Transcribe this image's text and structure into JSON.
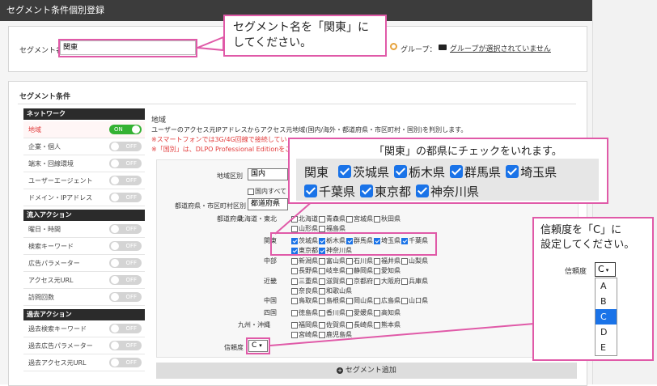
{
  "header": {
    "title": "セグメント条件個別登録"
  },
  "segment_name": {
    "label": "セグメント名",
    "value": "関東"
  },
  "group": {
    "label": "グループ：",
    "link": "グループが選択されていません"
  },
  "conditions_title": "セグメント条件",
  "sidebar": {
    "sections": [
      {
        "title": "ネットワーク",
        "items": [
          {
            "label": "地域",
            "toggle": "ON",
            "active": true
          },
          {
            "label": "企業・個人",
            "toggle": "OFF"
          },
          {
            "label": "端末・回線環境",
            "toggle": "OFF"
          },
          {
            "label": "ユーザーエージェント",
            "toggle": "OFF"
          },
          {
            "label": "ドメイン・IPアドレス",
            "toggle": "OFF"
          }
        ]
      },
      {
        "title": "流入アクション",
        "items": [
          {
            "label": "曜日・時間",
            "toggle": "OFF"
          },
          {
            "label": "検索キーワード",
            "toggle": "OFF"
          },
          {
            "label": "広告パラメーター",
            "toggle": "OFF"
          },
          {
            "label": "アクセス元URL",
            "toggle": "OFF"
          },
          {
            "label": "訪問回数",
            "toggle": "OFF"
          }
        ]
      },
      {
        "title": "過去アクション",
        "items": [
          {
            "label": "過去検索キーワード",
            "toggle": "OFF"
          },
          {
            "label": "過去広告パラメーター",
            "toggle": "OFF"
          },
          {
            "label": "過去アクセス元URL",
            "toggle": "OFF"
          }
        ]
      }
    ]
  },
  "region": {
    "title": "地域",
    "desc": "ユーザーのアクセス元IPアドレスからアクセス元地域(国内/海外・都道府県・市区町村・国別)を判別します。",
    "note1": "※スマートフォンでは3G/4G回線で接続してい",
    "note2": "※「国別」は、DLPO Professional Editionをご",
    "region_type_label": "地域区別",
    "region_type_value": "国内",
    "domestic_all": "国内すべて",
    "pref_city_label": "都道府県・市区町村区別",
    "pref_city_value": "都道府県",
    "pref_label": "都道府県",
    "rows": [
      {
        "area": "北海道・東北",
        "prefs": [
          [
            "北海道",
            false
          ],
          [
            "青森県",
            false
          ],
          [
            "宮城県",
            false
          ],
          [
            "秋田県",
            false
          ],
          [
            "山形県",
            false
          ],
          [
            "福島県",
            false
          ]
        ]
      },
      {
        "area": "関東",
        "prefs": [
          [
            "茨城県",
            true
          ],
          [
            "栃木県",
            true
          ],
          [
            "群馬県",
            true
          ],
          [
            "埼玉県",
            true
          ],
          [
            "千葉県",
            true
          ],
          [
            "東京都",
            true
          ],
          [
            "神奈川県",
            true
          ]
        ]
      },
      {
        "area": "中部",
        "prefs": [
          [
            "新潟県",
            false
          ],
          [
            "富山県",
            false
          ],
          [
            "石川県",
            false
          ],
          [
            "福井県",
            false
          ],
          [
            "山梨県",
            false
          ],
          [
            "長野県",
            false
          ],
          [
            "岐阜県",
            false
          ],
          [
            "静岡県",
            false
          ],
          [
            "愛知県",
            false
          ]
        ]
      },
      {
        "area": "近畿",
        "prefs": [
          [
            "三重県",
            false
          ],
          [
            "滋賀県",
            false
          ],
          [
            "京都府",
            false
          ],
          [
            "大阪府",
            false
          ],
          [
            "兵庫県",
            false
          ],
          [
            "奈良県",
            false
          ],
          [
            "和歌山県",
            false
          ]
        ]
      },
      {
        "area": "中国",
        "prefs": [
          [
            "鳥取県",
            false
          ],
          [
            "島根県",
            false
          ],
          [
            "岡山県",
            false
          ],
          [
            "広島県",
            false
          ],
          [
            "山口県",
            false
          ]
        ]
      },
      {
        "area": "四国",
        "prefs": [
          [
            "徳島県",
            false
          ],
          [
            "香川県",
            false
          ],
          [
            "愛媛県",
            false
          ],
          [
            "高知県",
            false
          ]
        ]
      },
      {
        "area": "九州・沖縄",
        "prefs": [
          [
            "福岡県",
            false
          ],
          [
            "佐賀県",
            false
          ],
          [
            "長崎県",
            false
          ],
          [
            "熊本県",
            false
          ],
          [
            "宮崎県",
            false
          ],
          [
            "鹿児島県",
            false
          ]
        ]
      }
    ],
    "reliability_label": "信頼度",
    "reliability_value": "C",
    "add_button": "セグメント追加"
  },
  "callouts": {
    "segment_name": "セグメント名を「関東」に\nしてください。",
    "kanto_check": "「関東」の都県にチェックをいれます。",
    "reliability": "信頼度を「C」に\n設定してください。"
  },
  "zoom_kanto": {
    "area": "関東",
    "prefs": [
      "茨城県",
      "栃木県",
      "群馬県",
      "埼玉県",
      "千葉県",
      "東京都",
      "神奈川県"
    ]
  },
  "zoom_reliability": {
    "label": "信頼度",
    "value": "C",
    "options": [
      "A",
      "B",
      "C",
      "D",
      "E"
    ],
    "selected": "C"
  },
  "colors": {
    "accent": "#e05aa8",
    "on": "#34b233",
    "check": "#1a73e8",
    "warn": "#e23b3b"
  }
}
